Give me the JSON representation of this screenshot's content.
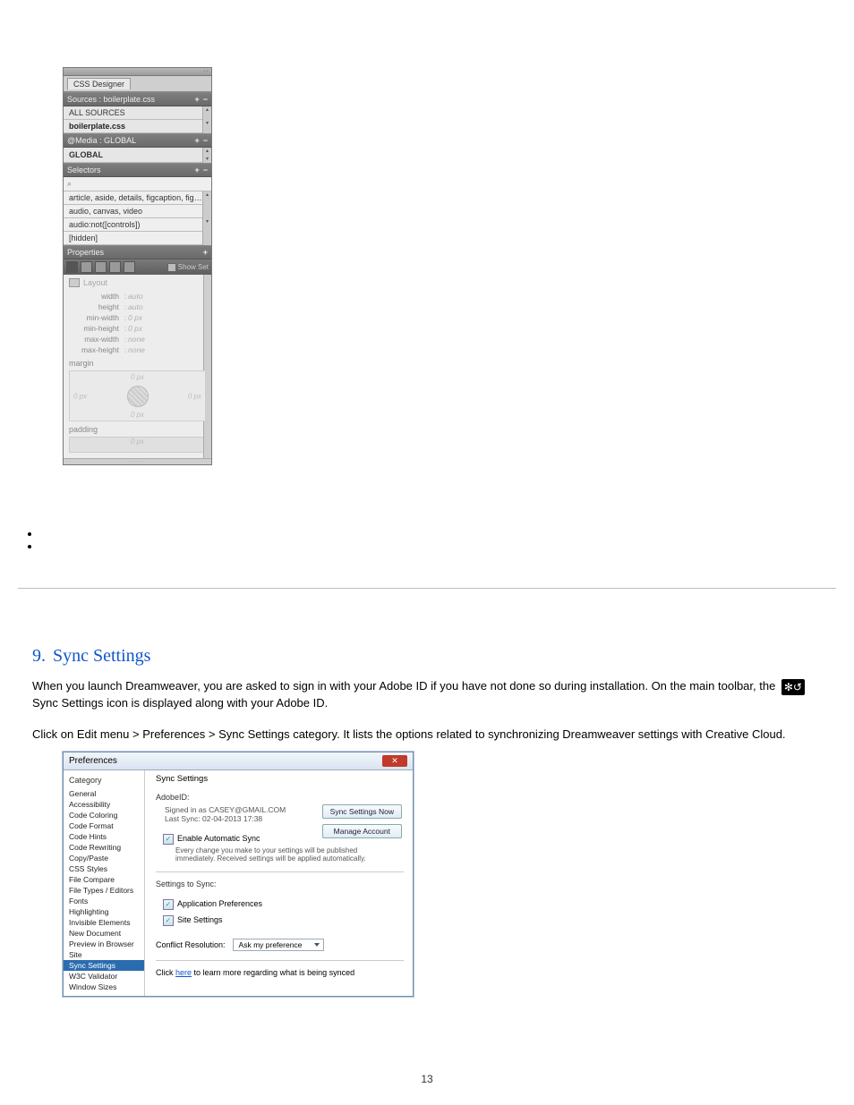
{
  "page_number": "13",
  "css_designer": {
    "tab_label": "CSS Designer",
    "sources": {
      "header": "Sources : boilerplate.css",
      "items": [
        "ALL SOURCES",
        "boilerplate.css"
      ]
    },
    "media": {
      "header": "@Media : GLOBAL",
      "items": [
        "GLOBAL"
      ]
    },
    "selectors": {
      "header": "Selectors",
      "search_glyph": "⌕",
      "items": [
        "article, aside, details, figcaption, figure, foo…",
        "audio, canvas, video",
        "audio:not([controls])",
        "[hidden]"
      ]
    },
    "properties": {
      "header": "Properties",
      "show_set": "Show Set",
      "layout_label": "Layout",
      "rows": [
        {
          "k": "width",
          "v": "auto"
        },
        {
          "k": "height",
          "v": "auto"
        },
        {
          "k": "min-width",
          "v": "0 px"
        },
        {
          "k": "min-height",
          "v": "0 px"
        },
        {
          "k": "max-width",
          "v": "none"
        },
        {
          "k": "max-height",
          "v": "none"
        }
      ],
      "margin_label": "margin",
      "margin_sides": {
        "top": "0 px",
        "right": "0 px",
        "bottom": "0 px",
        "left": "0 px"
      },
      "padding_label": "padding",
      "padding_top": "0 px"
    }
  },
  "document": {
    "heading_number": "9.",
    "heading_text": "Sync Settings",
    "para1_a": "When you launch Dreamweaver, you are asked to sign in with your Adobe ID if you have not done so during installation. On the main toolbar, the ",
    "para1_b": " Sync Settings icon is displayed along with your Adobe ID.",
    "para2": "Click on Edit menu > Preferences > Sync Settings category. It lists the options related to synchronizing Dreamweaver settings with Creative Cloud."
  },
  "prefs": {
    "title": "Preferences",
    "left_header": "Category",
    "categories": [
      "General",
      "Accessibility",
      "Code Coloring",
      "Code Format",
      "Code Hints",
      "Code Rewriting",
      "Copy/Paste",
      "CSS Styles",
      "File Compare",
      "File Types / Editors",
      "Fonts",
      "Highlighting",
      "Invisible Elements",
      "New Document",
      "Preview in Browser",
      "Site",
      "Sync Settings",
      "W3C Validator",
      "Window Sizes"
    ],
    "selected_category": "Sync Settings",
    "right_title": "Sync Settings",
    "adobe_id_label": "AdobeID:",
    "signed_in": "Signed in as CASEY@GMAIL.COM",
    "last_sync": "Last Sync: 02-04-2013 17:38",
    "btn_sync_now": "Sync Settings Now",
    "btn_manage": "Manage Account",
    "enable_auto": "Enable Automatic Sync",
    "enable_auto_desc": "Every change you make to your settings will be published immediately. Received settings will be applied automatically.",
    "settings_to_sync": "Settings to Sync:",
    "app_prefs": "Application Preferences",
    "site_settings": "Site Settings",
    "conflict_label": "Conflict Resolution:",
    "conflict_value": "Ask my preference",
    "click": "Click ",
    "here": "here",
    "click_tail": " to learn more regarding what is being synced"
  }
}
